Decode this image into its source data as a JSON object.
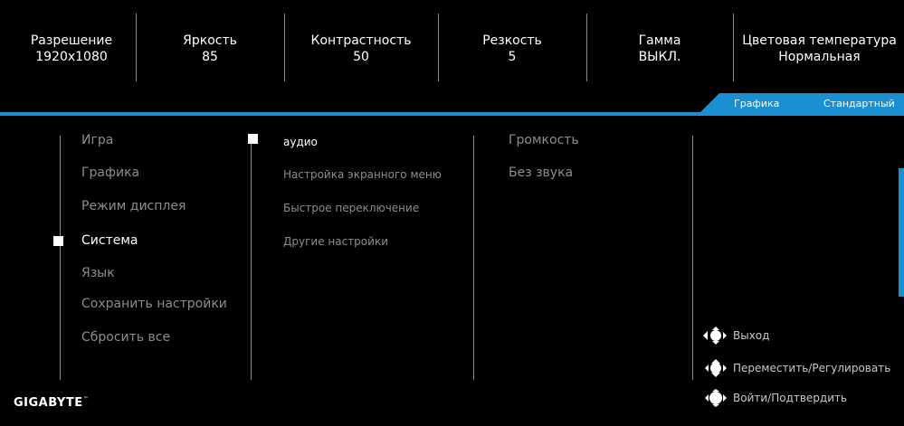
{
  "status_bar": [
    {
      "label": "Разрешение",
      "value": "1920x1080"
    },
    {
      "label": "Яркость",
      "value": "85"
    },
    {
      "label": "Контрастность",
      "value": "50"
    },
    {
      "label": "Резкость",
      "value": "5"
    },
    {
      "label": "Гамма",
      "value": "ВЫКЛ."
    },
    {
      "label": "Цветовая температура",
      "value": "Нормальная"
    }
  ],
  "mode_strip": {
    "category": "Графика",
    "preset": "Стандартный"
  },
  "main_menu": [
    {
      "label": "Игра",
      "active": false
    },
    {
      "label": "Графика",
      "active": false
    },
    {
      "label": "Режим дисплея",
      "active": false
    },
    {
      "label": "Система",
      "active": true
    },
    {
      "label": "Язык",
      "active": false
    },
    {
      "label": "Сохранить настройки",
      "active": false
    },
    {
      "label": "Сбросить все",
      "active": false
    }
  ],
  "sub_menu": [
    {
      "label": "аудио",
      "active": true
    },
    {
      "label": "Настройка экранного меню",
      "active": false
    },
    {
      "label": "Быстрое переключение",
      "active": false
    },
    {
      "label": "Другие настройки",
      "active": false
    }
  ],
  "options_menu": [
    {
      "label": "Громкость"
    },
    {
      "label": "Без звука"
    }
  ],
  "hints": [
    {
      "label": "Выход",
      "icon": "joystick-left-icon"
    },
    {
      "label": "Переместить/Регулировать",
      "icon": "joystick-updown-icon"
    },
    {
      "label": "Войти/Подтвердить",
      "icon": "joystick-press-icon"
    }
  ],
  "brand": {
    "name": "GIGABYTE",
    "mark": "™"
  },
  "colors": {
    "accent": "#1a8fd1",
    "inactive_text": "#8c8c8c",
    "background": "#000000"
  }
}
